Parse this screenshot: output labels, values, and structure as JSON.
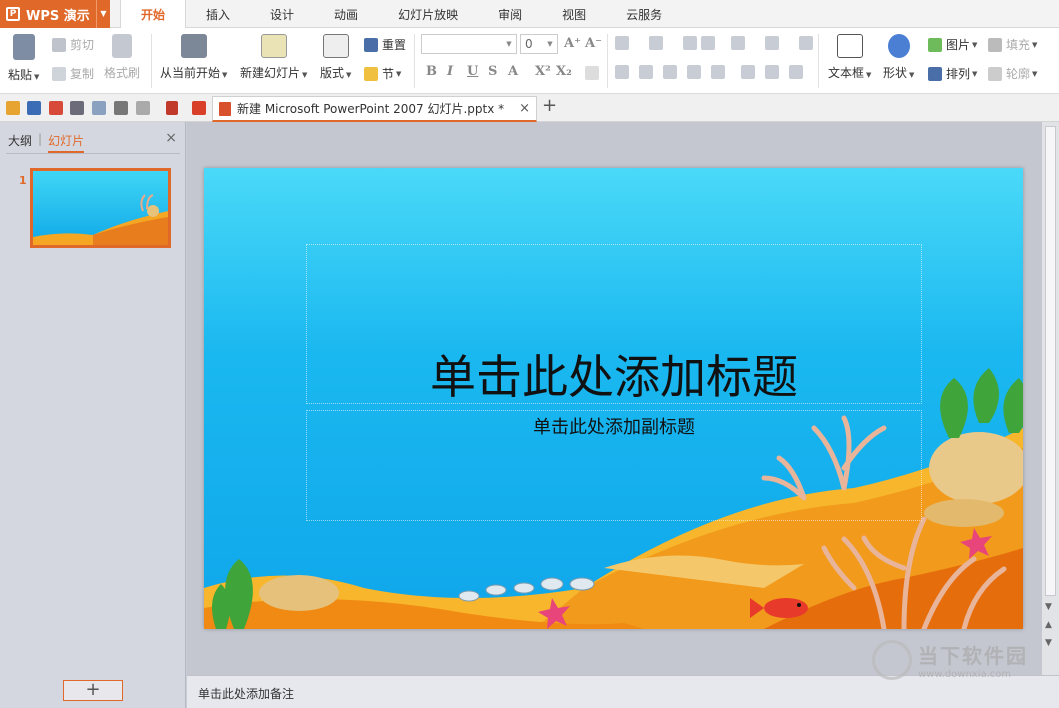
{
  "app": {
    "name": "WPS 演示",
    "logo_letter": "P",
    "menu_caret": "▼"
  },
  "tabs": [
    "开始",
    "插入",
    "设计",
    "动画",
    "幻灯片放映",
    "审阅",
    "视图",
    "云服务"
  ],
  "ribbon": {
    "paste": "粘贴",
    "cut": "剪切",
    "copy": "复制",
    "format_painter": "格式刷",
    "from_current": "从当前开始",
    "new_slide": "新建幻灯片",
    "layout": "版式",
    "reset": "重置",
    "section": "节",
    "font_size": "0",
    "text_box": "文本框",
    "shape": "形状",
    "picture": "图片",
    "arrange": "排列",
    "fill": "填充",
    "outline": "轮廓",
    "bold": "B",
    "italic": "I",
    "underline": "U",
    "strike": "S",
    "font_color": "A",
    "superscript": "X²",
    "subscript": "X₂",
    "grow": "A⁺",
    "shrink": "A⁻"
  },
  "document": {
    "tab_title": "新建 Microsoft PowerPoint 2007 幻灯片.pptx *",
    "close": "×",
    "new_tab": "+"
  },
  "left_panel": {
    "tab_outline": "大纲",
    "tab_slides": "幻灯片",
    "close": "×",
    "slide_number": "1",
    "add": "+"
  },
  "slide": {
    "title_placeholder": "单击此处添加标题",
    "subtitle_placeholder": "单击此处添加副标题"
  },
  "notes_placeholder": "单击此处添加备注",
  "watermark": {
    "line1": "当下软件园",
    "line2": "www.downxia.com"
  },
  "colors": {
    "accent": "#e0692a",
    "sea_top": "#4ad9f8",
    "sea_bottom": "#0fa6ea",
    "sand": "#f2a81f"
  }
}
